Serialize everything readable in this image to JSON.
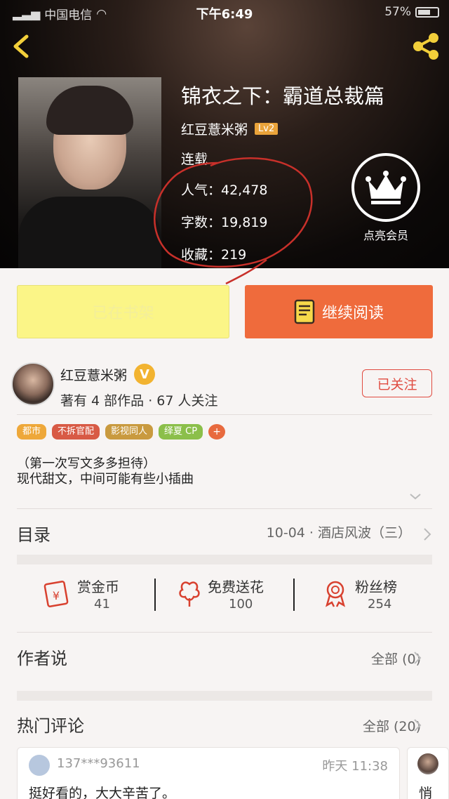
{
  "status_bar": {
    "carrier": "中国电信",
    "time": "下午6:49",
    "battery": "57%"
  },
  "book": {
    "title": "锦衣之下：霸道总裁篇",
    "author": "红豆薏米粥",
    "author_level": "Lv2",
    "status": "连载",
    "popularity_label": "人气：42,478",
    "word_count_label": "字数：19,819",
    "favorites_label": "收藏：219"
  },
  "vip": {
    "label": "点亮会员"
  },
  "actions": {
    "shelf_label": "已在书架",
    "read_label": "继续阅读"
  },
  "author_card": {
    "name": "红豆薏米粥",
    "subtitle": "著有 4 部作品 · 67 人关注",
    "follow_label": "已关注"
  },
  "tags": [
    {
      "label": "都市",
      "color": "#eea83a"
    },
    {
      "label": "不拆官配",
      "color": "#d85a45"
    },
    {
      "label": "影视同人",
      "color": "#c99a3f"
    },
    {
      "label": "绎夏 CP",
      "color": "#8bbf4a"
    }
  ],
  "tag_more": "+",
  "description": {
    "line1": "（第一次写文多多担待）",
    "line2": "现代甜文，中间可能有些小插曲"
  },
  "toc": {
    "label": "目录",
    "latest": "10-04 · 酒店风波（三）"
  },
  "rewards": [
    {
      "title": "赏金币",
      "value": "41"
    },
    {
      "title": "免费送花",
      "value": "100"
    },
    {
      "title": "粉丝榜",
      "value": "254"
    }
  ],
  "author_says": {
    "title": "作者说",
    "all_label": "全部 (0)"
  },
  "hot_comments": {
    "title": "热门评论",
    "all_label": "全部 (20)",
    "items": [
      {
        "user": "137***93611",
        "time": "昨天 11:38",
        "text": "挺好看的，大大辛苦了。"
      }
    ],
    "next_preview": "悄"
  },
  "colors": {
    "accent": "#ef6b3c",
    "shelf": "#fbf587",
    "follow": "#e04b40",
    "annotation": "#c8302a"
  }
}
